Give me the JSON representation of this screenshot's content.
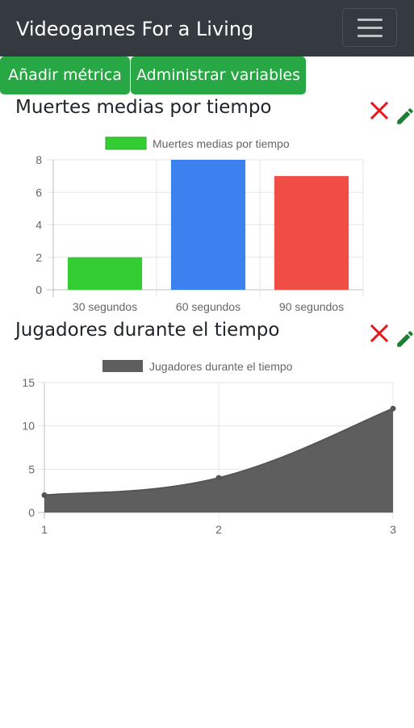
{
  "navbar": {
    "brand": "Videogames For a Living",
    "toggler_icon": "hamburger-icon"
  },
  "toolbar": {
    "add_metric_label": "Añadir métrica",
    "manage_variables_label": "Administrar variables"
  },
  "cards": [
    {
      "title": "Muertes medias por tiempo",
      "delete_icon": "close-icon",
      "edit_icon": "pencil-icon"
    },
    {
      "title": "Jugadores durante el tiempo",
      "delete_icon": "close-icon",
      "edit_icon": "pencil-icon"
    }
  ],
  "colors": {
    "navbar": "#343a40",
    "button": "#28a745",
    "delete": "#e3171c",
    "edit": "#1e7e34"
  },
  "chart_data": [
    {
      "type": "bar",
      "categories": [
        "30 segundos",
        "60 segundos",
        "90 segundos"
      ],
      "series": [
        {
          "name": "Muertes medias por tiempo",
          "values": [
            2,
            8,
            7
          ]
        }
      ],
      "bar_colors": [
        "#33cc33",
        "#3b82f0",
        "#f04e44"
      ],
      "ylim": [
        0,
        8
      ],
      "yticks": [
        0,
        2,
        4,
        6,
        8
      ],
      "legend": {
        "label": "Muertes medias por tiempo",
        "color": "#33cc33",
        "position": "top"
      },
      "grid": true
    },
    {
      "type": "area",
      "x": [
        1,
        2,
        3
      ],
      "series": [
        {
          "name": "Jugadores durante el tiempo",
          "values": [
            2,
            4,
            12
          ]
        }
      ],
      "ylim": [
        0,
        15
      ],
      "yticks": [
        0,
        5,
        10,
        15
      ],
      "xticks": [
        1,
        2,
        3
      ],
      "fill_color": "#5e5e5e",
      "legend": {
        "label": "Jugadores durante el tiempo",
        "color": "#5e5e5e",
        "position": "top"
      },
      "grid": true
    }
  ]
}
